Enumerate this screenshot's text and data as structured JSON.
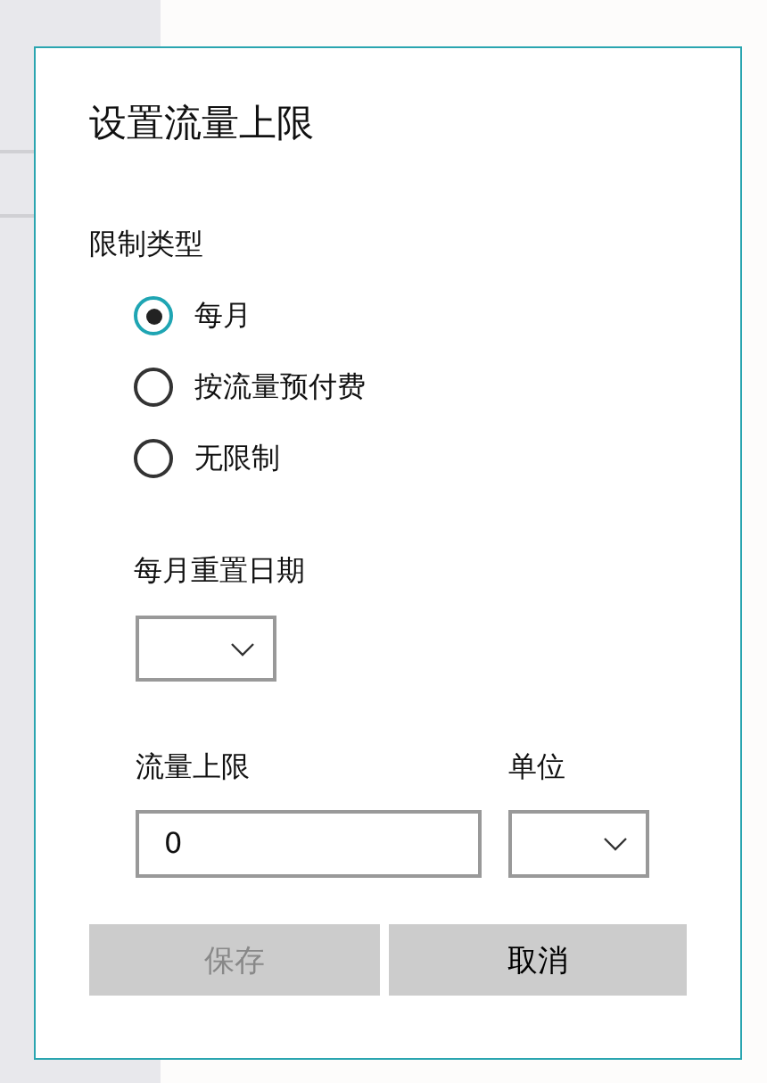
{
  "dialog": {
    "title": "设置流量上限",
    "limit_type": {
      "label": "限制类型",
      "options": [
        {
          "label": "每月",
          "selected": true
        },
        {
          "label": "按流量预付费",
          "selected": false
        },
        {
          "label": "无限制",
          "selected": false
        }
      ]
    },
    "reset_date": {
      "label": "每月重置日期"
    },
    "data_limit": {
      "label": "流量上限",
      "value": "0"
    },
    "unit": {
      "label": "单位"
    },
    "buttons": [
      {
        "label": "保存",
        "disabled": true
      },
      {
        "label": "取消",
        "disabled": false
      }
    ]
  }
}
